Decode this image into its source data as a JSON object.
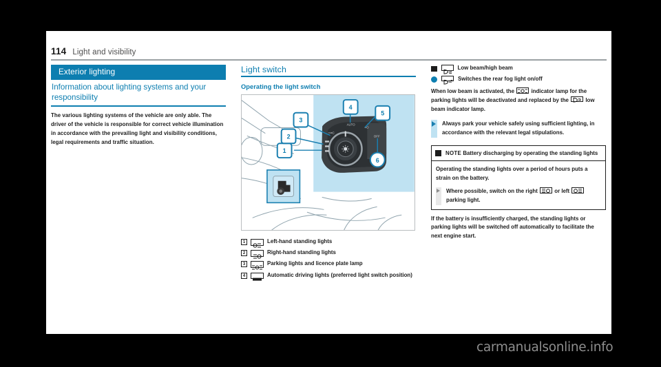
{
  "page": {
    "number": "114",
    "chapter": "Light and visibility"
  },
  "left_column": {
    "section_bar": "Exterior lighting",
    "sub_heading": "Information about lighting systems and your responsibility",
    "body": "The various lighting systems of the vehicle are only able. The driver of the vehicle is responsible for correct vehicle illumination in accordance with the prevailing light and visibility conditions, legal requirements and traffic situation."
  },
  "middle_column": {
    "heading": "Light switch",
    "sub_heading": "Operating the light switch",
    "figure": {
      "callouts": [
        "1",
        "2",
        "3",
        "4",
        "5",
        "6"
      ],
      "switch_labels": [
        "AUTO"
      ]
    },
    "legend": [
      {
        "num": "1",
        "symbol": "left-standing-light-symbol",
        "text": "Left-hand standing lights"
      },
      {
        "num": "2",
        "symbol": "right-standing-light-symbol",
        "text": "Right-hand standing lights"
      },
      {
        "num": "3",
        "symbol": "parking-light-symbol",
        "text": "Parking lights and licence plate lamp"
      },
      {
        "num": "4",
        "symbol": "automatic-driving-light-symbol",
        "text": "Automatic driving lights (preferred light switch position)"
      }
    ]
  },
  "right_column": {
    "items": [
      {
        "marker": "square",
        "symbol": "low-beam-symbol",
        "text": "Low beam/high beam"
      },
      {
        "marker": "circle",
        "symbol": "rear-fog-light-symbol",
        "text": "Switches the rear fog light on/off"
      }
    ],
    "paragraph_1_a": "When low beam is activated, the",
    "paragraph_1_b": "indicator lamp for the parking lights will be deactivated and replaced by the",
    "paragraph_1_c": "low beam indicator lamp.",
    "warning_bullet": "Always park your vehicle safely using sufficient lighting, in accordance with the relevant legal stipulations.",
    "note": {
      "label": "NOTE",
      "title": "Battery discharging by operating the standing lights",
      "body": "Operating the standing lights over a period of hours puts a strain on the battery.",
      "bullet_a": "Where possible, switch on the right",
      "bullet_b": "or left",
      "bullet_c": "parking light."
    },
    "closing_paragraph": "If the battery is insufficiently charged, the standing lights or parking lights will be switched off automatically to facilitate the next engine start."
  },
  "watermark": "carmanualsonline.info",
  "colors": {
    "accent_blue": "#0d7eb0",
    "light_blue_fill": "#bfe2f2",
    "page_bg": "#ffffff",
    "outer_bg": "#000000",
    "text": "#1c1c1c"
  }
}
